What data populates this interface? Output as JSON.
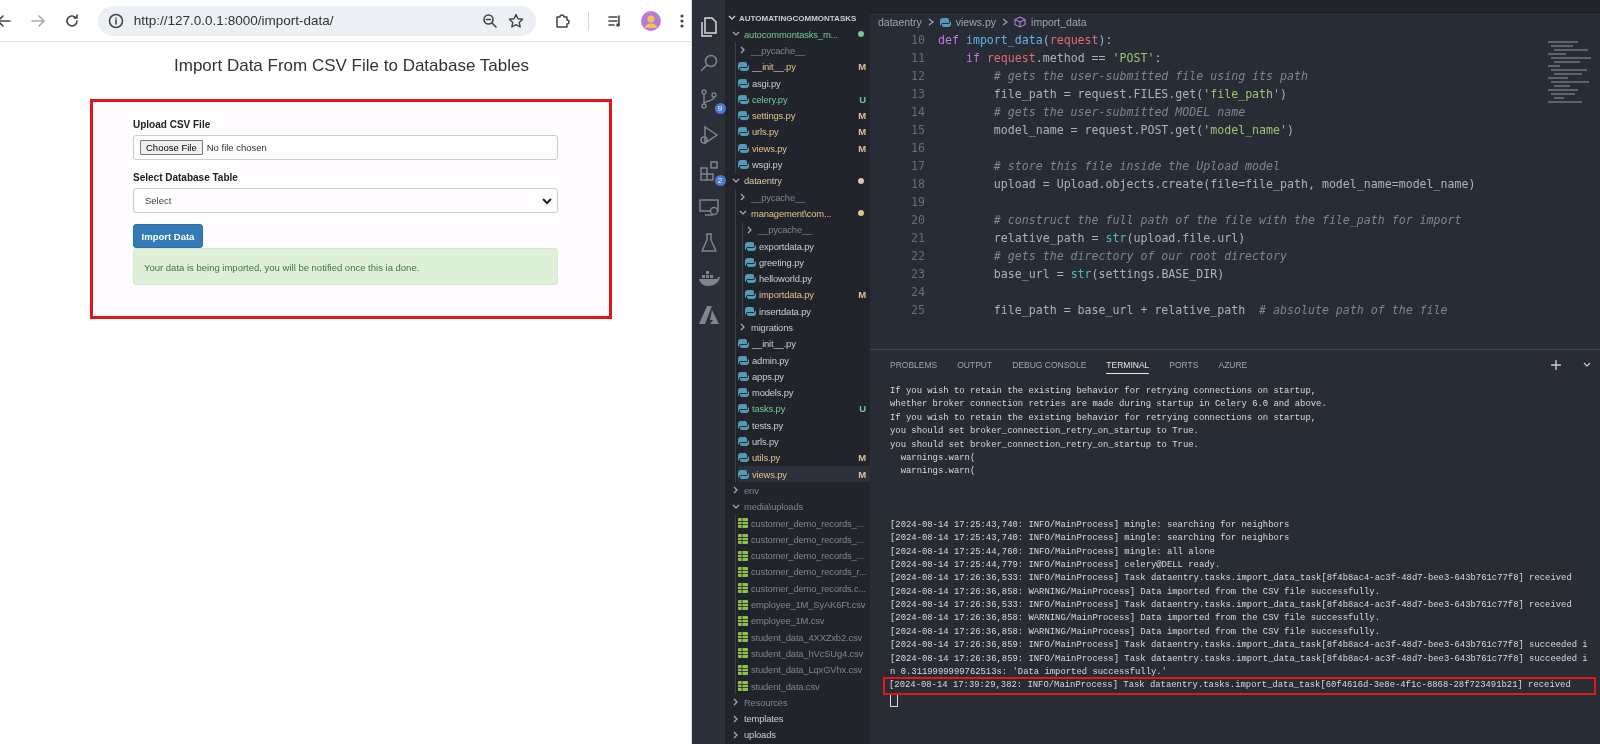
{
  "browser": {
    "url": "http://127.0.0.1:8000/import-data/",
    "page_title": "Import Data From CSV File to Database Tables",
    "form": {
      "highlighted": true,
      "file_label": "Upload CSV File",
      "choose_button": "Choose File",
      "file_status": "No file chosen",
      "table_label": "Select Database Table",
      "table_select": "Select",
      "submit_button": "Import Data",
      "alert": "Your data is being imported, you will be notified once this ia done."
    }
  },
  "activity_bar": [
    {
      "kind": "explorer",
      "selected": true
    },
    {
      "kind": "search",
      "selected": false
    },
    {
      "kind": "source-control",
      "selected": false,
      "badge": "9"
    },
    {
      "kind": "run",
      "selected": false
    },
    {
      "kind": "extensions",
      "selected": false,
      "badge": "2"
    },
    {
      "kind": "remote",
      "selected": false
    },
    {
      "kind": "testing",
      "selected": false
    },
    {
      "kind": "docker",
      "selected": false
    },
    {
      "kind": "azure",
      "selected": false
    }
  ],
  "explorer": {
    "root": "AUTOMATINGCOMMONTASKS",
    "root_expanded": true,
    "items": [
      {
        "name": "autocommontasks_m...",
        "kind": "folder",
        "expanded": true,
        "selected": false,
        "has_changes": true,
        "color": "#73c991",
        "children": [
          {
            "name": "__pycache__",
            "kind": "folder",
            "expanded": false,
            "selected": false,
            "ignored": true
          },
          {
            "name": "__init__.py",
            "kind": "python",
            "selected": false,
            "change": "M"
          },
          {
            "name": "asgi.py",
            "kind": "python",
            "selected": false
          },
          {
            "name": "celery.py",
            "kind": "python",
            "selected": false,
            "change": "U"
          },
          {
            "name": "settings.py",
            "kind": "python",
            "selected": false,
            "change": "M"
          },
          {
            "name": "urls.py",
            "kind": "python",
            "selected": false,
            "change": "M"
          },
          {
            "name": "views.py",
            "kind": "python",
            "selected": false,
            "change": "M"
          },
          {
            "name": "wsgi.py",
            "kind": "python",
            "selected": false
          }
        ]
      },
      {
        "name": "dataentry",
        "kind": "folder",
        "expanded": true,
        "selected": false,
        "has_changes": true,
        "color": "#d8c7a6",
        "children": [
          {
            "name": "__pycache__",
            "kind": "folder",
            "expanded": false,
            "selected": false,
            "ignored": true
          },
          {
            "name": "management\\com...",
            "kind": "folder",
            "expanded": true,
            "selected": false,
            "has_changes": true,
            "color": "#e2c08d",
            "children": [
              {
                "name": "__pycache__",
                "kind": "folder",
                "expanded": false,
                "selected": false,
                "ignored": true
              },
              {
                "name": "exportdata.py",
                "kind": "python",
                "selected": false
              },
              {
                "name": "greeting.py",
                "kind": "python",
                "selected": false
              },
              {
                "name": "helloworld.py",
                "kind": "python",
                "selected": false
              },
              {
                "name": "importdata.py",
                "kind": "python",
                "selected": false,
                "change": "M"
              },
              {
                "name": "insertdata.py",
                "kind": "python",
                "selected": false
              }
            ]
          },
          {
            "name": "migrations",
            "kind": "folder",
            "expanded": false,
            "selected": false
          },
          {
            "name": "__init__.py",
            "kind": "python",
            "selected": false
          },
          {
            "name": "admin.py",
            "kind": "python",
            "selected": false
          },
          {
            "name": "apps.py",
            "kind": "python",
            "selected": false
          },
          {
            "name": "models.py",
            "kind": "python",
            "selected": false
          },
          {
            "name": "tasks.py",
            "kind": "python",
            "selected": false,
            "change": "U"
          },
          {
            "name": "tests.py",
            "kind": "python",
            "selected": false
          },
          {
            "name": "urls.py",
            "kind": "python",
            "selected": false
          },
          {
            "name": "utils.py",
            "kind": "python",
            "selected": false,
            "change": "M"
          },
          {
            "name": "views.py",
            "kind": "python",
            "selected": true,
            "change": "M"
          }
        ]
      },
      {
        "name": "env",
        "kind": "folder",
        "expanded": false,
        "selected": false,
        "ignored": true
      },
      {
        "name": "media\\uploads",
        "kind": "folder",
        "expanded": true,
        "selected": false,
        "ignored": true,
        "children": [
          {
            "name": "customer_demo_records_...",
            "kind": "csv",
            "selected": false,
            "ignored": true
          },
          {
            "name": "customer_demo_records_...",
            "kind": "csv",
            "selected": false,
            "ignored": true
          },
          {
            "name": "customer_demo_records_...",
            "kind": "csv",
            "selected": false,
            "ignored": true
          },
          {
            "name": "customer_demo_records_r...",
            "kind": "csv",
            "selected": false,
            "ignored": true
          },
          {
            "name": "customer_demo_records.c...",
            "kind": "csv",
            "selected": false,
            "ignored": true
          },
          {
            "name": "employee_1M_SyAK6Ft.csv",
            "kind": "csv",
            "selected": false,
            "ignored": true
          },
          {
            "name": "employee_1M.csv",
            "kind": "csv",
            "selected": false,
            "ignored": true
          },
          {
            "name": "student_data_4XXZxb2.csv",
            "kind": "csv",
            "selected": false,
            "ignored": true
          },
          {
            "name": "student_data_hVcSUg4.csv",
            "kind": "csv",
            "selected": false,
            "ignored": true
          },
          {
            "name": "student_data_LqxGVhx.csv",
            "kind": "csv",
            "selected": false,
            "ignored": true
          },
          {
            "name": "student_data.csv",
            "kind": "csv",
            "selected": false,
            "ignored": true
          }
        ]
      },
      {
        "name": "Resources",
        "kind": "folder",
        "expanded": false,
        "selected": false,
        "ignored": true
      },
      {
        "name": "templates",
        "kind": "folder",
        "expanded": false,
        "selected": false
      },
      {
        "name": "uploads",
        "kind": "folder",
        "expanded": false,
        "selected": false
      }
    ]
  },
  "breadcrumb": [
    {
      "label": "dataentry",
      "kind": "folder"
    },
    {
      "label": "views.py",
      "kind": "python"
    },
    {
      "label": "import_data",
      "kind": "method"
    }
  ],
  "code": [
    {
      "number": "10",
      "segments": [
        {
          "kind": "kw",
          "text": "def "
        },
        {
          "kind": "fn",
          "text": "import_data"
        },
        {
          "kind": "plain",
          "text": "("
        },
        {
          "kind": "var",
          "text": "request"
        },
        {
          "kind": "plain",
          "text": "):"
        }
      ]
    },
    {
      "number": "11",
      "segments": [
        {
          "kind": "kw",
          "text": "    if "
        },
        {
          "kind": "var",
          "text": "request"
        },
        {
          "kind": "plain",
          "text": ".method == "
        },
        {
          "kind": "str",
          "text": "'POST'"
        },
        {
          "kind": "plain",
          "text": ":"
        }
      ]
    },
    {
      "number": "12",
      "segments": [
        {
          "kind": "comment",
          "text": "        # gets the user-submitted file using its path"
        }
      ]
    },
    {
      "number": "13",
      "segments": [
        {
          "kind": "plain",
          "text": "        file_path = request.FILES.get("
        },
        {
          "kind": "str",
          "text": "'file_path'"
        },
        {
          "kind": "plain",
          "text": ")"
        }
      ]
    },
    {
      "number": "14",
      "segments": [
        {
          "kind": "comment",
          "text": "        # gets the user-submitted MODEL name"
        }
      ]
    },
    {
      "number": "15",
      "segments": [
        {
          "kind": "plain",
          "text": "        model_name = request.POST.get("
        },
        {
          "kind": "str",
          "text": "'model_name'"
        },
        {
          "kind": "plain",
          "text": ")"
        }
      ]
    },
    {
      "number": "16"
    },
    {
      "number": "17",
      "segments": [
        {
          "kind": "comment",
          "text": "        # store this file inside the Upload model"
        }
      ]
    },
    {
      "number": "18",
      "segments": [
        {
          "kind": "plain",
          "text": "        upload = Upload.objects.create(file=file_path, model_name=model_name)"
        }
      ]
    },
    {
      "number": "19"
    },
    {
      "number": "20",
      "segments": [
        {
          "kind": "comment",
          "text": "        # construct the full path of the file with the file_path for import"
        }
      ]
    },
    {
      "number": "21",
      "segments": [
        {
          "kind": "plain",
          "text": "        relative_path = "
        },
        {
          "kind": "builtin",
          "text": "str"
        },
        {
          "kind": "plain",
          "text": "(upload.file.url)"
        }
      ]
    },
    {
      "number": "22",
      "segments": [
        {
          "kind": "comment",
          "text": "        # gets the directory of our root directory"
        }
      ]
    },
    {
      "number": "23",
      "segments": [
        {
          "kind": "plain",
          "text": "        base_url = "
        },
        {
          "kind": "builtin",
          "text": "str"
        },
        {
          "kind": "plain",
          "text": "(settings.BASE_DIR)"
        }
      ]
    },
    {
      "number": "24"
    },
    {
      "number": "25",
      "segments": [
        {
          "kind": "plain",
          "text": "        file_path = base_url + relative_path  "
        },
        {
          "kind": "comment",
          "text": "# absolute path of the file"
        }
      ]
    }
  ],
  "panel": {
    "tabs": [
      {
        "label": "PROBLEMS",
        "selected": false
      },
      {
        "label": "OUTPUT",
        "selected": false
      },
      {
        "label": "DEBUG CONSOLE",
        "selected": false
      },
      {
        "label": "TERMINAL",
        "selected": true
      },
      {
        "label": "PORTS",
        "selected": false
      },
      {
        "label": "AZURE",
        "selected": false
      }
    ],
    "terminal": {
      "cursor": true,
      "blocks": [
        [
          {
            "text": "If you wish to retain the existing behavior for retrying connections on startup,"
          },
          {
            "text": "whether broker connection retries are made during startup in Celery 6.0 and above."
          },
          {
            "text": "If you wish to retain the existing behavior for retrying connections on startup,"
          },
          {
            "text": "you should set broker_connection_retry_on_startup to True."
          },
          {
            "text": "you should set broker_connection_retry_on_startup to True."
          },
          {
            "text": "  warnings.warn("
          },
          {
            "text": "  warnings.warn("
          }
        ],
        [
          {
            "text": "[2024-08-14 17:25:43,740: INFO/MainProcess] mingle: searching for neighbors"
          },
          {
            "text": "[2024-08-14 17:25:43,740: INFO/MainProcess] mingle: searching for neighbors"
          },
          {
            "text": "[2024-08-14 17:25:44,760: INFO/MainProcess] mingle: all alone"
          },
          {
            "text": "[2024-08-14 17:25:44,779: INFO/MainProcess] celery@DELL ready."
          },
          {
            "text": "[2024-08-14 17:26:36,533: INFO/MainProcess] Task dataentry.tasks.import_data_task[8f4b8ac4-ac3f-48d7-bee3-643b761c77f8] received"
          },
          {
            "text": "[2024-08-14 17:26:36,858: WARNING/MainProcess] Data imported from the CSV file successfully."
          },
          {
            "text": "[2024-08-14 17:26:36,533: INFO/MainProcess] Task dataentry.tasks.import_data_task[8f4b8ac4-ac3f-48d7-bee3-643b761c77f8] received"
          },
          {
            "text": "[2024-08-14 17:26:36,858: WARNING/MainProcess] Data imported from the CSV file successfully."
          },
          {
            "text": "[2024-08-14 17:26:36,858: WARNING/MainProcess] Data imported from the CSV file successfully."
          },
          {
            "text": "[2024-08-14 17:26:36,859: INFO/MainProcess] Task dataentry.tasks.import_data_task[8f4b8ac4-ac3f-48d7-bee3-643b761c77f8] succeeded i"
          },
          {
            "text": "[2024-08-14 17:26:36,859: INFO/MainProcess] Task dataentry.tasks.import_data_task[8f4b8ac4-ac3f-48d7-bee3-643b761c77f8] succeeded i"
          },
          {
            "text": "n 0.3119999999762513s: 'Data imported successfully.'"
          },
          {
            "text": "[2024-08-14 17:39:29,382: INFO/MainProcess] Task dataentry.tasks.import_data_task[60f4616d-3e8e-4f1c-8868-28f723491b21] received",
            "highlighted": true
          }
        ]
      ]
    }
  }
}
